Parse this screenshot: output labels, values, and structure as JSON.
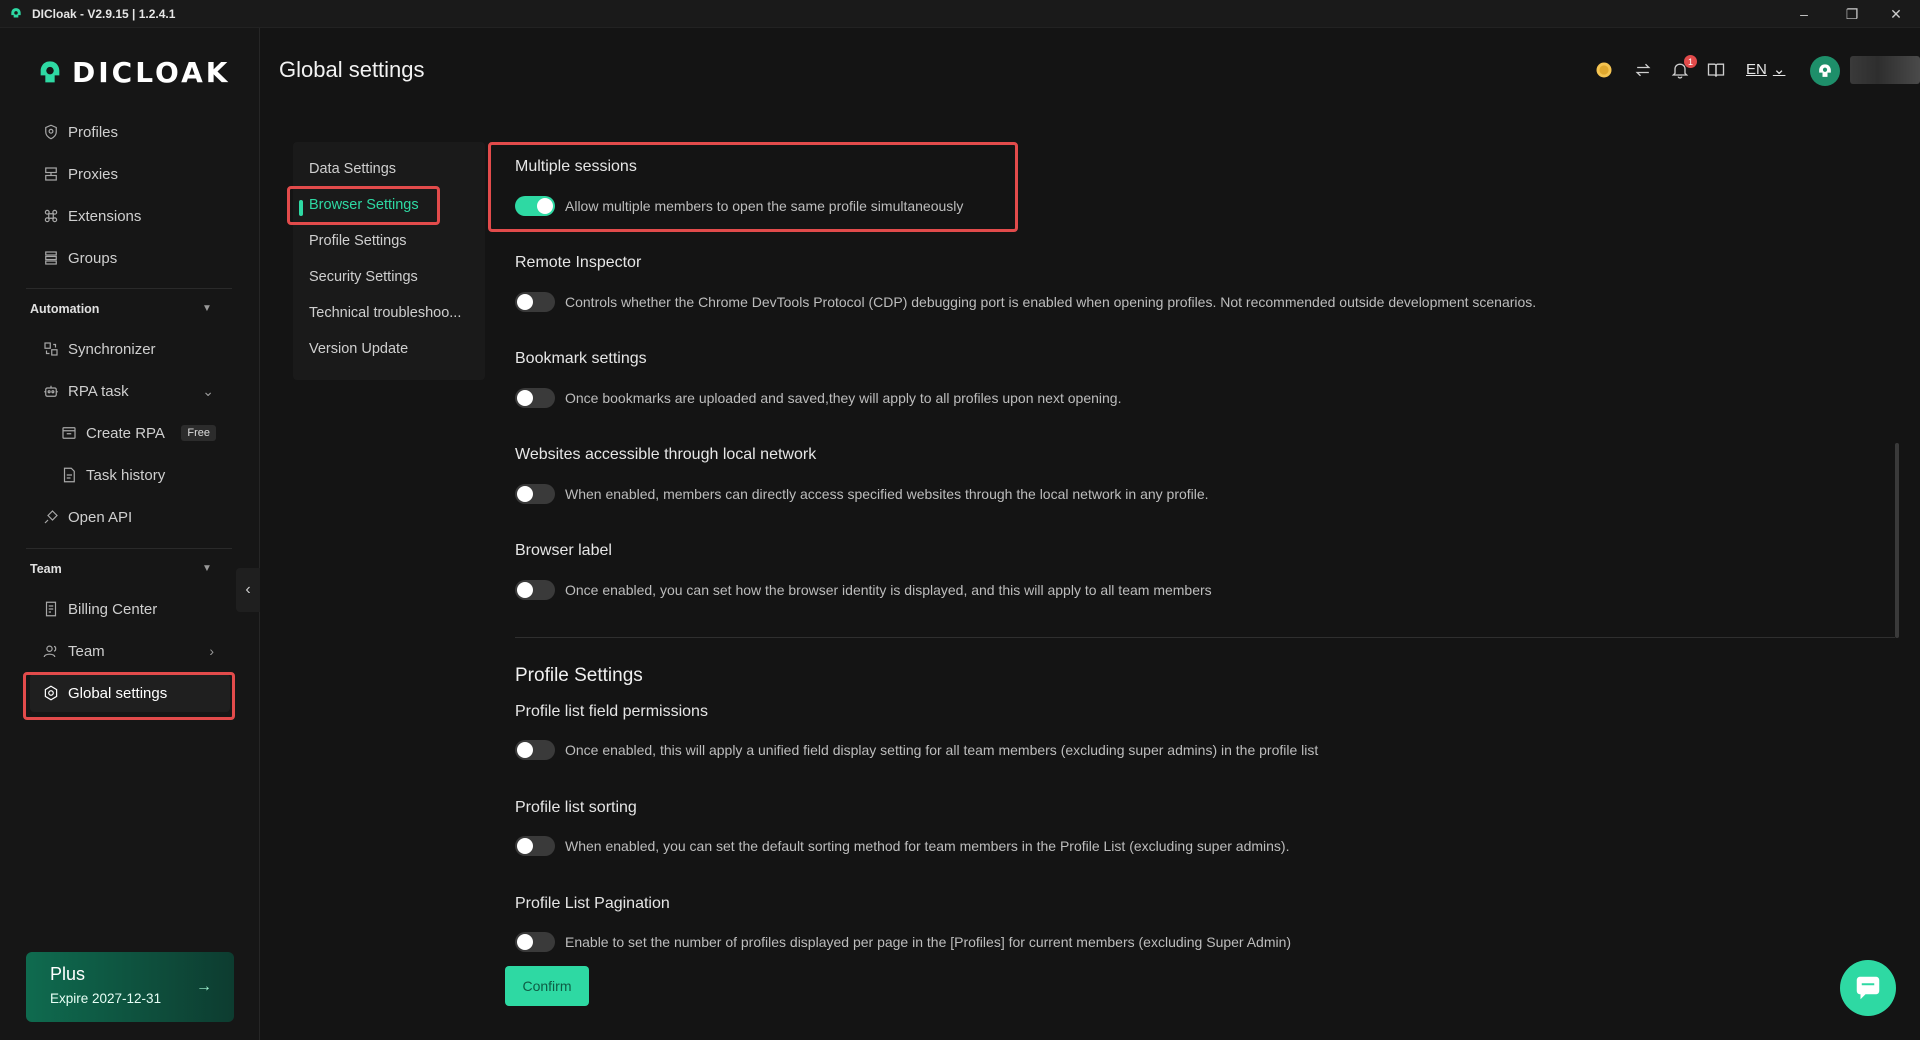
{
  "window": {
    "title": "DICloak - V2.9.15 | 1.2.4.1",
    "controls": [
      "–",
      "❐",
      "✕"
    ]
  },
  "brand": {
    "logo_text": "DICLOAK",
    "accent": "#2ed9a3"
  },
  "sidebar": {
    "items": [
      {
        "label": "Profiles"
      },
      {
        "label": "Proxies"
      },
      {
        "label": "Extensions"
      },
      {
        "label": "Groups"
      }
    ],
    "automation": {
      "label": "Automation",
      "items": [
        {
          "label": "Synchronizer"
        },
        {
          "label": "RPA task"
        },
        {
          "label": "Create RPA",
          "badge": "Free"
        },
        {
          "label": "Task history"
        },
        {
          "label": "Open API"
        }
      ]
    },
    "team": {
      "label": "Team",
      "items": [
        {
          "label": "Billing Center"
        },
        {
          "label": "Team"
        },
        {
          "label": "Global settings"
        }
      ]
    },
    "plan": {
      "name": "Plus",
      "expire": "Expire 2027-12-31"
    }
  },
  "header": {
    "page_title": "Global settings",
    "lang": "EN",
    "notif_count": "1"
  },
  "subnav": {
    "items": [
      "Data Settings",
      "Browser Settings",
      "Profile Settings",
      "Security Settings",
      "Technical troubleshoo...",
      "Version Update"
    ],
    "active": "Browser Settings"
  },
  "browser_settings": [
    {
      "title": "Multiple sessions",
      "desc": "Allow multiple members to open the same profile simultaneously",
      "enabled": true
    },
    {
      "title": "Remote Inspector",
      "desc": "Controls whether the Chrome DevTools Protocol (CDP) debugging port is enabled when opening profiles. Not recommended outside development scenarios.",
      "enabled": false
    },
    {
      "title": "Bookmark settings",
      "desc": "Once bookmarks are uploaded and saved,they will apply to all profiles upon next opening.",
      "enabled": false
    },
    {
      "title": "Websites accessible through local network",
      "desc": "When enabled, members can directly access specified websites through the local network in any profile.",
      "enabled": false
    },
    {
      "title": "Browser label",
      "desc": "Once enabled, you can set how the browser identity is displayed, and this will apply to all team members",
      "enabled": false
    }
  ],
  "profile_settings": {
    "heading": "Profile Settings",
    "items": [
      {
        "title": "Profile list field permissions",
        "desc": "Once enabled, this will apply a unified field display setting for all team members (excluding super admins) in the profile list",
        "enabled": false
      },
      {
        "title": "Profile list sorting",
        "desc": "When enabled, you can set the default sorting method for team members in the Profile List (excluding super admins).",
        "enabled": false
      },
      {
        "title": "Profile List Pagination",
        "desc": "Enable to set the number of profiles displayed per page in the [Profiles] for current members (excluding Super Admin)",
        "enabled": false
      }
    ]
  },
  "confirm_label": "Confirm"
}
